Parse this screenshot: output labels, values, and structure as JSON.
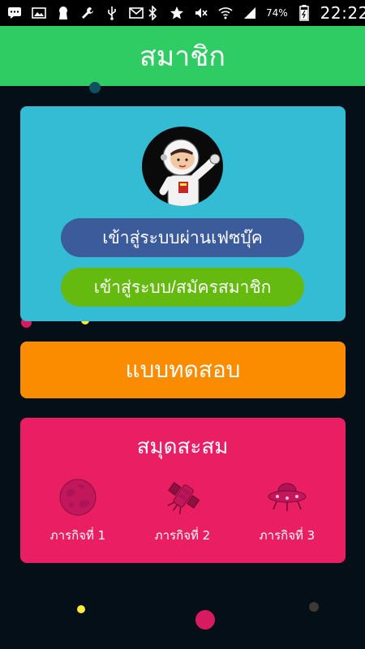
{
  "status_bar": {
    "battery_percent": "74%",
    "time": "22:22"
  },
  "header": {
    "title": "สมาชิก"
  },
  "login": {
    "facebook_label": "เข้าสู่ระบบผ่านเฟซบุ๊ค",
    "member_label": "เข้าสู่ระบบ/สมัครสมาชิก"
  },
  "test": {
    "label": "แบบทดสอบ"
  },
  "collection": {
    "title": "สมุดสะสม",
    "missions": [
      {
        "label": "ภารกิจที่ 1",
        "icon": "planet-icon"
      },
      {
        "label": "ภารกิจที่ 2",
        "icon": "satellite-icon"
      },
      {
        "label": "ภารกิจที่ 3",
        "icon": "ufo-icon"
      }
    ]
  },
  "colors": {
    "header": "#2ecc63",
    "login_card": "#33bcd4",
    "facebook_button": "#3b5b9b",
    "member_button": "#65ba0f",
    "test_card": "#fb8c00",
    "collection_card": "#e91e63",
    "background": "#050f18"
  }
}
